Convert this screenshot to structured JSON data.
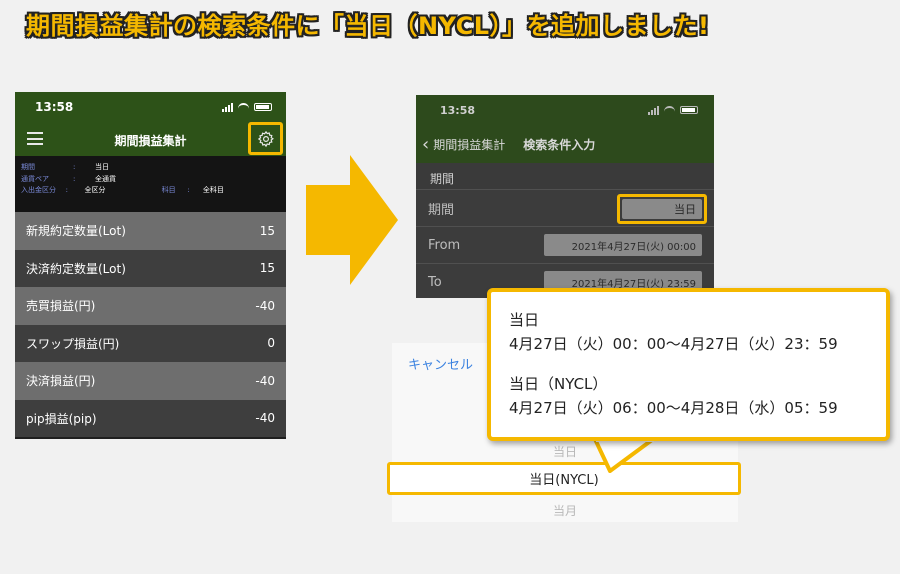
{
  "headline": "期間損益集計の検索条件に「当日（NYCL）」を追加しました!",
  "colors": {
    "accent": "#f5b800",
    "nav_green": "#2d5218",
    "link_blue": "#3b82e0"
  },
  "left_phone": {
    "time": "13:58",
    "title": "期間損益集計",
    "menu_icon": "hamburger-icon",
    "settings_icon": "gear-icon",
    "criteria": {
      "period_label": "期間",
      "period_value": "当日",
      "pair_label": "通貨ペア",
      "pair_value": "全通貨",
      "inout_label": "入出金区分",
      "inout_value": "全区分",
      "subject_label": "科目",
      "subject_value": "全科目",
      "separator": ":"
    },
    "rows": [
      {
        "label": "新規約定数量(Lot)",
        "value": "15"
      },
      {
        "label": "決済約定数量(Lot)",
        "value": "15"
      },
      {
        "label": "売買損益(円)",
        "value": "-40"
      },
      {
        "label": "スワップ損益(円)",
        "value": "0"
      },
      {
        "label": "決済損益(円)",
        "value": "-40"
      },
      {
        "label": "pip損益(pip)",
        "value": "-40"
      }
    ]
  },
  "right_phone": {
    "time": "13:58",
    "back_label": "期間損益集計",
    "title": "検索条件入力",
    "section": "期間",
    "period_label": "期間",
    "period_value": "当日",
    "from_label": "From",
    "from_value": "2021年4月27日(火) 00:00",
    "to_label": "To",
    "to_value": "2021年4月27日(火) 23:59"
  },
  "picker": {
    "cancel": "キャンセル",
    "options": [
      "当日",
      "当日(NYCL)",
      "当月"
    ],
    "selected": "当日(NYCL)"
  },
  "callout": {
    "line1_title": "当日",
    "line1_range": "4月27日（火）00：00〜4月27日（火）23：59",
    "line2_title": "当日（NYCL）",
    "line2_range": "4月27日（火）06：00〜4月28日（水）05：59"
  }
}
